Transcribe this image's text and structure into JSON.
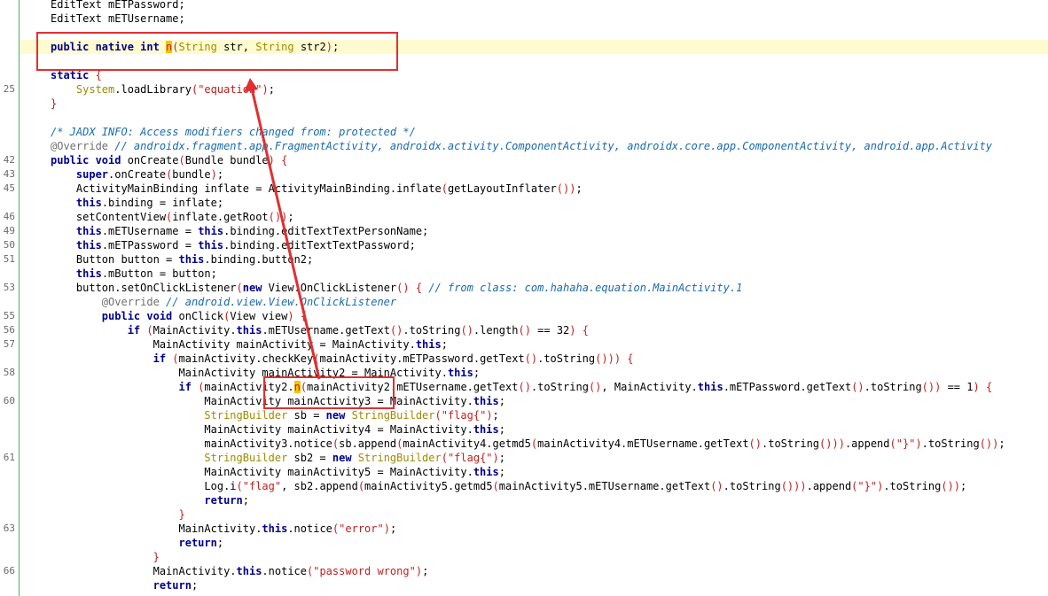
{
  "lines": [
    {
      "num": "",
      "segs": [
        [
          "",
          "EditText mETPassword;"
        ]
      ]
    },
    {
      "num": "",
      "segs": [
        [
          "",
          "EditText mETUsername;"
        ]
      ]
    },
    {
      "num": "",
      "segs": []
    },
    {
      "num": "",
      "hl": true,
      "segs": [
        [
          "kw",
          "public native int "
        ],
        [
          "mark",
          "n"
        ],
        [
          "pn",
          "("
        ],
        [
          "tp",
          "String"
        ],
        [
          "",
          " str, "
        ],
        [
          "tp",
          "String"
        ],
        [
          "",
          " str2"
        ],
        [
          "pn",
          ")"
        ],
        [
          "",
          ";"
        ]
      ]
    },
    {
      "num": "",
      "segs": []
    },
    {
      "num": "",
      "segs": [
        [
          "kw",
          "static "
        ],
        [
          "pn",
          "{"
        ]
      ]
    },
    {
      "num": "25",
      "segs": [
        [
          "",
          "    "
        ],
        [
          "tp",
          "System"
        ],
        [
          "",
          ".loadLibrary"
        ],
        [
          "pn",
          "("
        ],
        [
          "st",
          "\"equation\""
        ],
        [
          "pn",
          ")"
        ],
        [
          "",
          ";"
        ]
      ]
    },
    {
      "num": "",
      "segs": [
        [
          "pn",
          "}"
        ]
      ]
    },
    {
      "num": "",
      "segs": []
    },
    {
      "num": "",
      "segs": [
        [
          "cm",
          "/* JADX INFO: Access modifiers changed from: protected */"
        ]
      ]
    },
    {
      "num": "",
      "segs": [
        [
          "an",
          "@Override "
        ],
        [
          "cm",
          "// androidx.fragment.app.FragmentActivity, androidx.activity.ComponentActivity, androidx.core.app.ComponentActivity, android.app.Activity"
        ]
      ]
    },
    {
      "num": "42",
      "segs": [
        [
          "kw",
          "public void "
        ],
        [
          "",
          "onCreate"
        ],
        [
          "pn",
          "("
        ],
        [
          "",
          "Bundle bundle"
        ],
        [
          "pn",
          ")"
        ],
        [
          "",
          " "
        ],
        [
          "pn",
          "{"
        ]
      ]
    },
    {
      "num": "43",
      "segs": [
        [
          "",
          "    "
        ],
        [
          "kw",
          "super"
        ],
        [
          "",
          ".onCreate"
        ],
        [
          "pn",
          "("
        ],
        [
          "",
          "bundle"
        ],
        [
          "pn",
          ")"
        ],
        [
          "",
          ";"
        ]
      ]
    },
    {
      "num": "45",
      "segs": [
        [
          "",
          "    ActivityMainBinding inflate = ActivityMainBinding.inflate"
        ],
        [
          "pn",
          "("
        ],
        [
          "",
          "getLayoutInflater"
        ],
        [
          "pn",
          "()"
        ],
        [
          "pn",
          ")"
        ],
        [
          "",
          ";"
        ]
      ]
    },
    {
      "num": "",
      "segs": [
        [
          "",
          "    "
        ],
        [
          "kw",
          "this"
        ],
        [
          "",
          ".binding = inflate;"
        ]
      ]
    },
    {
      "num": "46",
      "segs": [
        [
          "",
          "    setContentView"
        ],
        [
          "pn",
          "("
        ],
        [
          "",
          "inflate.getRoot"
        ],
        [
          "pn",
          "()"
        ],
        [
          "pn",
          ")"
        ],
        [
          "",
          ";"
        ]
      ]
    },
    {
      "num": "49",
      "segs": [
        [
          "",
          "    "
        ],
        [
          "kw",
          "this"
        ],
        [
          "",
          ".mETUsername = "
        ],
        [
          "kw",
          "this"
        ],
        [
          "",
          ".binding.editTextTextPersonName;"
        ]
      ]
    },
    {
      "num": "50",
      "segs": [
        [
          "",
          "    "
        ],
        [
          "kw",
          "this"
        ],
        [
          "",
          ".mETPassword = "
        ],
        [
          "kw",
          "this"
        ],
        [
          "",
          ".binding.editTextTextPassword;"
        ]
      ]
    },
    {
      "num": "51",
      "segs": [
        [
          "",
          "    Button button = "
        ],
        [
          "kw",
          "this"
        ],
        [
          "",
          ".binding.button2;"
        ]
      ]
    },
    {
      "num": "",
      "segs": [
        [
          "",
          "    "
        ],
        [
          "kw",
          "this"
        ],
        [
          "",
          ".mButton = button;"
        ]
      ]
    },
    {
      "num": "53",
      "segs": [
        [
          "",
          "    button.setOnClickListener"
        ],
        [
          "pn",
          "("
        ],
        [
          "kw",
          "new "
        ],
        [
          "",
          "View.OnClickListener"
        ],
        [
          "pn",
          "()"
        ],
        [
          "",
          " "
        ],
        [
          "pn",
          "{"
        ],
        [
          "",
          " "
        ],
        [
          "cm",
          "// from class: com.hahaha.equation.MainActivity.1"
        ]
      ]
    },
    {
      "num": "",
      "segs": [
        [
          "",
          "        "
        ],
        [
          "an",
          "@Override "
        ],
        [
          "cm",
          "// android.view.View.OnClickListener"
        ]
      ]
    },
    {
      "num": "55",
      "segs": [
        [
          "",
          "        "
        ],
        [
          "kw",
          "public void "
        ],
        [
          "",
          "onClick"
        ],
        [
          "pn",
          "("
        ],
        [
          "",
          "View view"
        ],
        [
          "pn",
          ")"
        ],
        [
          "",
          " "
        ],
        [
          "pn",
          "{"
        ]
      ]
    },
    {
      "num": "56",
      "segs": [
        [
          "",
          "            "
        ],
        [
          "kw",
          "if "
        ],
        [
          "pn",
          "("
        ],
        [
          "",
          "MainActivity."
        ],
        [
          "kw",
          "this"
        ],
        [
          "",
          ".mETUsername.getText"
        ],
        [
          "pn",
          "()"
        ],
        [
          "",
          ".toString"
        ],
        [
          "pn",
          "()"
        ],
        [
          "",
          ".length"
        ],
        [
          "pn",
          "()"
        ],
        [
          "",
          " == 32"
        ],
        [
          "pn",
          ")"
        ],
        [
          "",
          " "
        ],
        [
          "pn",
          "{"
        ]
      ]
    },
    {
      "num": "57",
      "segs": [
        [
          "",
          "                MainActivity mainActivity = MainActivity."
        ],
        [
          "kw",
          "this"
        ],
        [
          "",
          ";"
        ]
      ]
    },
    {
      "num": "",
      "segs": [
        [
          "",
          "                "
        ],
        [
          "kw",
          "if "
        ],
        [
          "pn",
          "("
        ],
        [
          "",
          "mainActivity.checkKey"
        ],
        [
          "pn",
          "("
        ],
        [
          "",
          "mainActivity.mETPassword.getText"
        ],
        [
          "pn",
          "()"
        ],
        [
          "",
          ".toString"
        ],
        [
          "pn",
          "()"
        ],
        [
          "pn",
          "))"
        ],
        [
          "",
          " "
        ],
        [
          "pn",
          "{"
        ]
      ]
    },
    {
      "num": "58",
      "segs": [
        [
          "",
          "                    MainActivity mainActivity2 = MainActivity."
        ],
        [
          "kw",
          "this"
        ],
        [
          "",
          ";"
        ]
      ]
    },
    {
      "num": "",
      "segs": [
        [
          "",
          "                    "
        ],
        [
          "kw",
          "if "
        ],
        [
          "pn",
          "("
        ],
        [
          "",
          "mainActivity2."
        ],
        [
          "mark",
          "n"
        ],
        [
          "pn",
          "("
        ],
        [
          "",
          "mainActivity2.mETUsername.getText"
        ],
        [
          "pn",
          "()"
        ],
        [
          "",
          ".toString"
        ],
        [
          "pn",
          "()"
        ],
        [
          "",
          ", MainActivity."
        ],
        [
          "kw",
          "this"
        ],
        [
          "",
          ".mETPassword.getText"
        ],
        [
          "pn",
          "()"
        ],
        [
          "",
          ".toString"
        ],
        [
          "pn",
          "()"
        ],
        [
          "pn",
          ")"
        ],
        [
          "",
          " == 1"
        ],
        [
          "pn",
          ")"
        ],
        [
          "",
          " "
        ],
        [
          "pn",
          "{"
        ]
      ]
    },
    {
      "num": "60",
      "segs": [
        [
          "",
          "                        MainActivity mainActivity3 = MainActivity."
        ],
        [
          "kw",
          "this"
        ],
        [
          "",
          ";"
        ]
      ]
    },
    {
      "num": "",
      "segs": [
        [
          "",
          "                        "
        ],
        [
          "tp",
          "StringBuilder"
        ],
        [
          "",
          " sb = "
        ],
        [
          "kw",
          "new "
        ],
        [
          "tp",
          "StringBuilder"
        ],
        [
          "pn",
          "("
        ],
        [
          "st",
          "\"flag{\""
        ],
        [
          "pn",
          ")"
        ],
        [
          "",
          ";"
        ]
      ]
    },
    {
      "num": "",
      "segs": [
        [
          "",
          "                        MainActivity mainActivity4 = MainActivity."
        ],
        [
          "kw",
          "this"
        ],
        [
          "",
          ";"
        ]
      ]
    },
    {
      "num": "",
      "segs": [
        [
          "",
          "                        mainActivity3.notice"
        ],
        [
          "pn",
          "("
        ],
        [
          "",
          "sb.append"
        ],
        [
          "pn",
          "("
        ],
        [
          "",
          "mainActivity4.getmd5"
        ],
        [
          "pn",
          "("
        ],
        [
          "",
          "mainActivity4.mETUsername.getText"
        ],
        [
          "pn",
          "()"
        ],
        [
          "",
          ".toString"
        ],
        [
          "pn",
          "()"
        ],
        [
          "pn",
          "))"
        ],
        [
          "",
          ".append"
        ],
        [
          "pn",
          "("
        ],
        [
          "st",
          "\"}\""
        ],
        [
          "pn",
          ")"
        ],
        [
          "",
          ".toString"
        ],
        [
          "pn",
          "())"
        ],
        [
          "",
          ";"
        ]
      ]
    },
    {
      "num": "61",
      "segs": [
        [
          "",
          "                        "
        ],
        [
          "tp",
          "StringBuilder"
        ],
        [
          "",
          " sb2 = "
        ],
        [
          "kw",
          "new "
        ],
        [
          "tp",
          "StringBuilder"
        ],
        [
          "pn",
          "("
        ],
        [
          "st",
          "\"flag{\""
        ],
        [
          "pn",
          ")"
        ],
        [
          "",
          ";"
        ]
      ]
    },
    {
      "num": "",
      "segs": [
        [
          "",
          "                        MainActivity mainActivity5 = MainActivity."
        ],
        [
          "kw",
          "this"
        ],
        [
          "",
          ";"
        ]
      ]
    },
    {
      "num": "",
      "segs": [
        [
          "",
          "                        Log.i"
        ],
        [
          "pn",
          "("
        ],
        [
          "st",
          "\"flag\""
        ],
        [
          "",
          ", sb2.append"
        ],
        [
          "pn",
          "("
        ],
        [
          "",
          "mainActivity5.getmd5"
        ],
        [
          "pn",
          "("
        ],
        [
          "",
          "mainActivity5.mETUsername.getText"
        ],
        [
          "pn",
          "()"
        ],
        [
          "",
          ".toString"
        ],
        [
          "pn",
          "()"
        ],
        [
          "pn",
          "))"
        ],
        [
          "",
          ".append"
        ],
        [
          "pn",
          "("
        ],
        [
          "st",
          "\"}\""
        ],
        [
          "pn",
          ")"
        ],
        [
          "",
          ".toString"
        ],
        [
          "pn",
          "())"
        ],
        [
          "",
          ";"
        ]
      ]
    },
    {
      "num": "",
      "segs": [
        [
          "",
          "                        "
        ],
        [
          "kw",
          "return"
        ],
        [
          "",
          ";"
        ]
      ]
    },
    {
      "num": "",
      "segs": [
        [
          "",
          "                    "
        ],
        [
          "pn",
          "}"
        ]
      ]
    },
    {
      "num": "63",
      "segs": [
        [
          "",
          "                    MainActivity."
        ],
        [
          "kw",
          "this"
        ],
        [
          "",
          ".notice"
        ],
        [
          "pn",
          "("
        ],
        [
          "st",
          "\"error\""
        ],
        [
          "pn",
          ")"
        ],
        [
          "",
          ";"
        ]
      ]
    },
    {
      "num": "",
      "segs": [
        [
          "",
          "                    "
        ],
        [
          "kw",
          "return"
        ],
        [
          "",
          ";"
        ]
      ]
    },
    {
      "num": "",
      "segs": [
        [
          "",
          "                "
        ],
        [
          "pn",
          "}"
        ]
      ]
    },
    {
      "num": "66",
      "segs": [
        [
          "",
          "                MainActivity."
        ],
        [
          "kw",
          "this"
        ],
        [
          "",
          ".notice"
        ],
        [
          "pn",
          "("
        ],
        [
          "st",
          "\"password wrong\""
        ],
        [
          "pn",
          ")"
        ],
        [
          "",
          ";"
        ]
      ]
    },
    {
      "num": "",
      "segs": [
        [
          "",
          "                "
        ],
        [
          "kw",
          "return"
        ],
        [
          "",
          ";"
        ]
      ]
    }
  ],
  "colors": {
    "keyword": "#00008b",
    "type": "#a08a00",
    "string": "#c02020",
    "comment": "#1a6ab0",
    "highlight_line": "#fffbd0",
    "search_match": "#f7c400",
    "annotation_box": "#e03030",
    "gutter_border": "#4caf50"
  }
}
